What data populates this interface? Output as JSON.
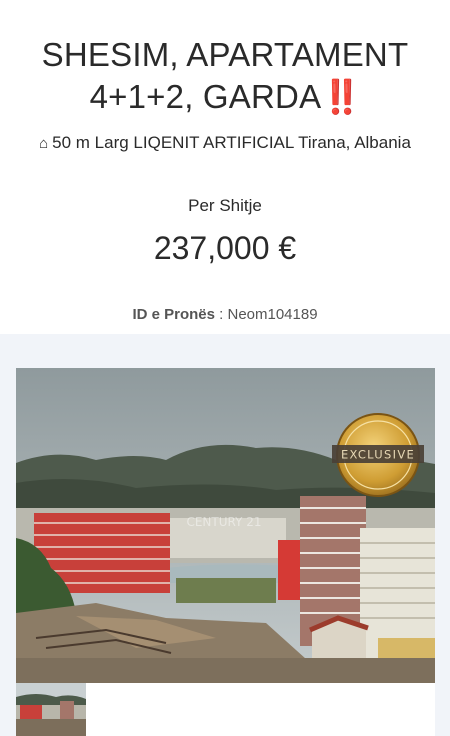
{
  "listing": {
    "title_line1": "SHESIM, APARTAMENT",
    "title_line2": "4+1+2, GARDA",
    "title_emoji": "‼️",
    "location": "50 m Larg LIQENIT ARTIFICIAL Tirana, Albania",
    "status": "Per Shitje",
    "price": "237,000 €",
    "property_id_label": "ID e Pronës",
    "property_id_sep": " : ",
    "property_id": "Neom104189"
  },
  "gallery": {
    "badge_text": "EXCLUSIVE",
    "watermark": "CENTURY 21"
  },
  "icons": {
    "location": "home-icon"
  },
  "colors": {
    "text": "#2a2a2a",
    "accent_red": "#e0201b",
    "gallery_bg": "#f1f4f9",
    "badge_gold": "#c99a2e"
  }
}
